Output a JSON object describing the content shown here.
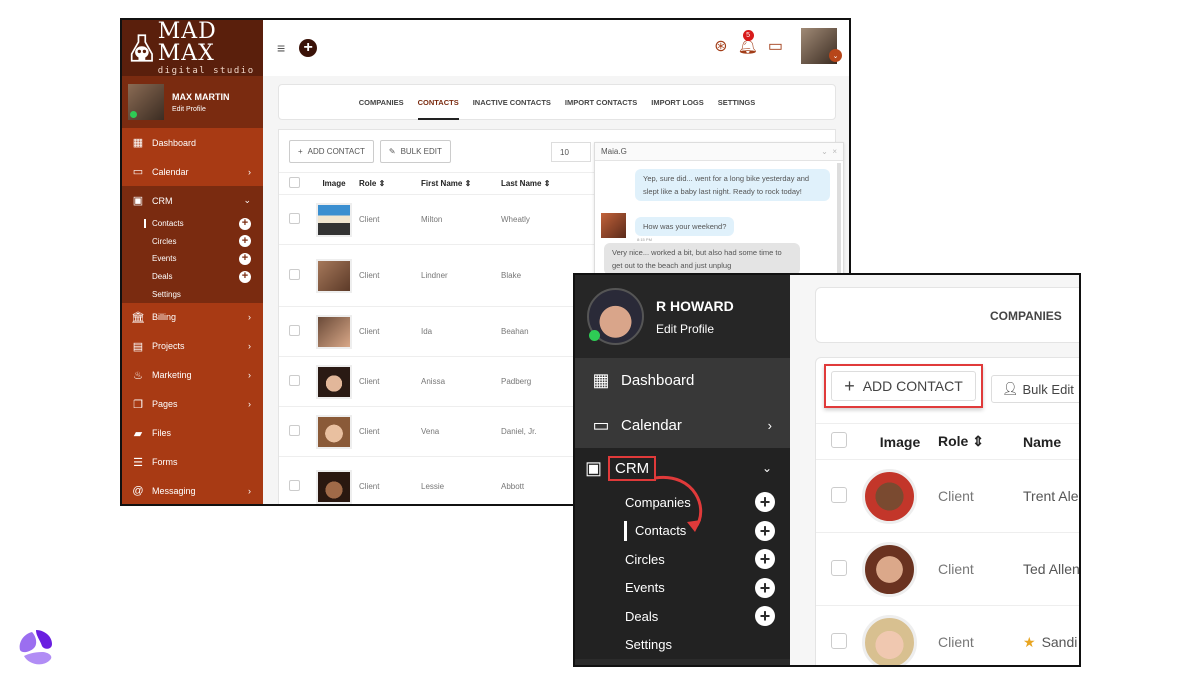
{
  "back_app": {
    "brand": {
      "title": "MAD MAX",
      "subtitle": "digital studio"
    },
    "profile": {
      "name": "MAX MARTIN",
      "edit_label": "Edit Profile",
      "status": "online"
    },
    "sidebar": {
      "items": [
        {
          "label": "Dashboard",
          "icon": "dashboard-icon",
          "chevron": false
        },
        {
          "label": "Calendar",
          "icon": "calendar-icon",
          "chevron": true
        },
        {
          "label": "CRM",
          "icon": "crm-icon",
          "chevron": true,
          "expanded": true
        }
      ],
      "crm_sub": [
        {
          "label": "Contacts",
          "active": true,
          "add": true
        },
        {
          "label": "Circles",
          "add": true
        },
        {
          "label": "Events",
          "add": true
        },
        {
          "label": "Deals",
          "add": true
        },
        {
          "label": "Settings",
          "add": false
        }
      ],
      "items_after": [
        {
          "label": "Billing",
          "icon": "bank-icon",
          "chevron": true
        },
        {
          "label": "Projects",
          "icon": "projects-icon",
          "chevron": true
        },
        {
          "label": "Marketing",
          "icon": "fire-icon",
          "chevron": true
        },
        {
          "label": "Pages",
          "icon": "pages-icon",
          "chevron": true
        },
        {
          "label": "Files",
          "icon": "folder-icon",
          "chevron": false
        },
        {
          "label": "Forms",
          "icon": "list-icon",
          "chevron": false
        },
        {
          "label": "Messaging",
          "icon": "at-icon",
          "chevron": true
        }
      ]
    },
    "topbar": {
      "notification_count": "5"
    },
    "tabs": [
      "COMPANIES",
      "CONTACTS",
      "INACTIVE CONTACTS",
      "IMPORT CONTACTS",
      "IMPORT LOGS",
      "SETTINGS"
    ],
    "active_tab": "CONTACTS",
    "actions": {
      "add_contact": "ADD CONTACT",
      "bulk_edit": "BULK EDIT",
      "page_size": "10"
    },
    "table": {
      "headers": [
        "Image",
        "Role",
        "First Name",
        "Last Name"
      ],
      "rows": [
        {
          "role": "Client",
          "first": "Milton",
          "last": "Wheatly"
        },
        {
          "role": "Client",
          "first": "Lindner",
          "last": "Blake"
        },
        {
          "role": "Client",
          "first": "Ida",
          "last": "Beahan"
        },
        {
          "role": "Client",
          "first": "Anissa",
          "last": "Padberg"
        },
        {
          "role": "Client",
          "first": "Vena",
          "last": "Daniel, Jr."
        },
        {
          "role": "Client",
          "first": "Lessie",
          "last": "Abbott"
        }
      ]
    },
    "chat": {
      "contact": "Maia.G",
      "messages": [
        {
          "dir": "in",
          "text": "Yep, sure did... went for a long bike yesterday and slept like a baby last night. Ready to rock today!"
        },
        {
          "dir": "in",
          "text": "How was your weekend?",
          "time": "8:15 PM"
        },
        {
          "dir": "out",
          "text": "Very nice... worked a bit, but also had some time to get out to the beach and just unplug"
        }
      ]
    }
  },
  "front_app": {
    "profile": {
      "name": "R HOWARD",
      "edit_label": "Edit Profile",
      "status": "online"
    },
    "sidebar": {
      "items": [
        {
          "label": "Dashboard",
          "icon": "dashboard-icon",
          "chevron": false
        },
        {
          "label": "Calendar",
          "icon": "calendar-icon",
          "chevron": true
        }
      ],
      "crm_label": "CRM",
      "crm_sub": [
        {
          "label": "Companies",
          "add": true
        },
        {
          "label": "Contacts",
          "active": true,
          "add": true
        },
        {
          "label": "Circles",
          "add": true
        },
        {
          "label": "Events",
          "add": true
        },
        {
          "label": "Deals",
          "add": true
        },
        {
          "label": "Settings",
          "add": false
        }
      ]
    },
    "tabs": [
      "COMPANIES"
    ],
    "actions": {
      "add_contact": "ADD CONTACT",
      "bulk_edit": "Bulk Edit"
    },
    "table": {
      "headers": [
        "Image",
        "Role",
        "Name"
      ],
      "rows": [
        {
          "role": "Client",
          "name": "Trent Ale",
          "starred": false
        },
        {
          "role": "Client",
          "name": "Ted Allen",
          "starred": false
        },
        {
          "role": "Client",
          "name": "Sandi",
          "starred": true
        }
      ]
    },
    "highlight_color": "#e03a3a"
  }
}
